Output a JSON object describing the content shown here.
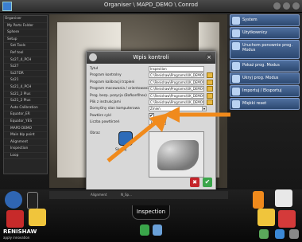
{
  "window": {
    "title": "Organiser \\ MAPD_DEMO \\ Conrod"
  },
  "tree": {
    "items": [
      "Organiser",
      "My Parts Folder",
      "Sphere",
      "Setup",
      "Set Tools",
      "Ref tool",
      "Sz27_4_PCH",
      "Sz27",
      "Sz27DR",
      "Sz21",
      "Sz21_4_PCH",
      "Sz21_2 Plus",
      "Sz21_2 Plus",
      "Auto Calibration",
      "Equator_ER",
      "Equator_YES",
      "MAPD DEMO",
      "Main blp point",
      "Alignment",
      "Inspection",
      "Loop"
    ]
  },
  "right_menu": {
    "items": [
      {
        "label": "System",
        "tall": false
      },
      {
        "label": "Użytkownicy",
        "tall": false
      },
      {
        "label": "Uruchom ponownie prog. Modus",
        "tall": true
      },
      {
        "label": "Pokaż prog. Modus",
        "tall": false
      },
      {
        "label": "Ukryj prog. Modus",
        "tall": false
      },
      {
        "label": "Importuj / Eksportuj",
        "tall": false
      },
      {
        "label": "Miękki reset",
        "tall": false
      }
    ]
  },
  "dialog": {
    "title": "Wpis kontroli",
    "fields": [
      {
        "label": "Tytuł",
        "value": "Inspection",
        "kind": "text"
      },
      {
        "label": "Program kontrolny",
        "value": "C:\\Renishaw\\Programs\\UK_DEMO\\Con",
        "kind": "path"
      },
      {
        "label": "Program kalibracji trzpieni",
        "value": "C:\\Renishaw\\Programs\\UK_DEMO\\Con Rod\\",
        "kind": "path"
      },
      {
        "label": "Program mocowania / orientowania",
        "value": "C:\\Renishaw\\Programs\\UK_DEMO\\Con Rod\\",
        "kind": "path"
      },
      {
        "label": "Prog. bezp. pozycja (Bafkonfihex)",
        "value": "C:\\Renishaw\\Programs\\UK_DEMO\\Con Rod\\",
        "kind": "path"
      },
      {
        "label": "Plik z instrukcjami",
        "value": "C:\\Renishaw\\Programs\\UK_DEMO\\Whlistr",
        "kind": "path"
      },
      {
        "label": "Domyślny stan komputerowa",
        "value": "Zmień",
        "kind": "dropdown"
      },
      {
        "label": "Powtórz cykl",
        "value": "✔",
        "kind": "check"
      },
      {
        "label": "Liczba powtórzeń",
        "value": "1000",
        "kind": "number"
      }
    ],
    "image_label": "Obraz",
    "scan_label": "Skanuj",
    "ok": "✔",
    "cancel": "✖"
  },
  "status_strip": {
    "left": "Alignment",
    "right": "N_Sp..."
  },
  "bottom": {
    "tab_label": "Inspection",
    "brand": "RENISHAW",
    "brand_sub": "apply innovation"
  },
  "colors": {
    "accent": "#f08a1c",
    "menu_blue": "#3c5f93"
  }
}
